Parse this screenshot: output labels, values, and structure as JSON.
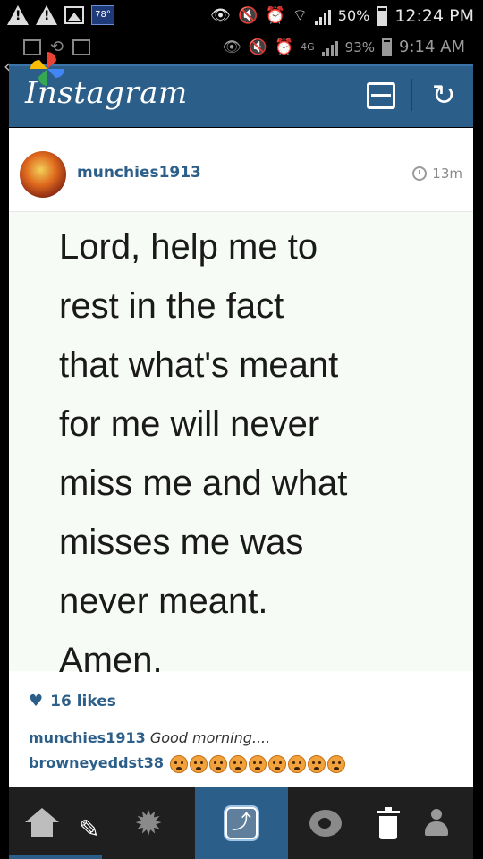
{
  "status_bar": {
    "temperature": "78°",
    "battery": "50%",
    "time": "12:24 PM"
  },
  "status_bar_secondary": {
    "battery": "93%",
    "time": "9:14 AM",
    "network": "4G"
  },
  "app": {
    "title": "Instagram"
  },
  "post": {
    "username": "munchies1913",
    "timestamp": "13m",
    "quote_lines": [
      "Lord, help me to",
      "rest in the fact",
      "that what's meant",
      "for me will never",
      "miss me and what",
      "misses me was",
      "never meant.",
      "Amen."
    ],
    "likes": "16 likes",
    "comments": [
      {
        "user": "munchies1913",
        "text": "Good morning...."
      },
      {
        "user": "browneyeddst38",
        "emoji_count": 9
      }
    ]
  },
  "colors": {
    "brand": "#2c5e8a",
    "nav_bg": "#1f1f1f",
    "photo_bg": "#f7fbf5"
  },
  "icons": {
    "header": [
      "inbox-icon",
      "refresh-icon"
    ],
    "nav": [
      "home-icon",
      "explore-icon",
      "camera-icon",
      "activity-icon",
      "profile-icon"
    ],
    "overlay": [
      "pencil-icon",
      "share-icon",
      "trash-icon"
    ]
  }
}
